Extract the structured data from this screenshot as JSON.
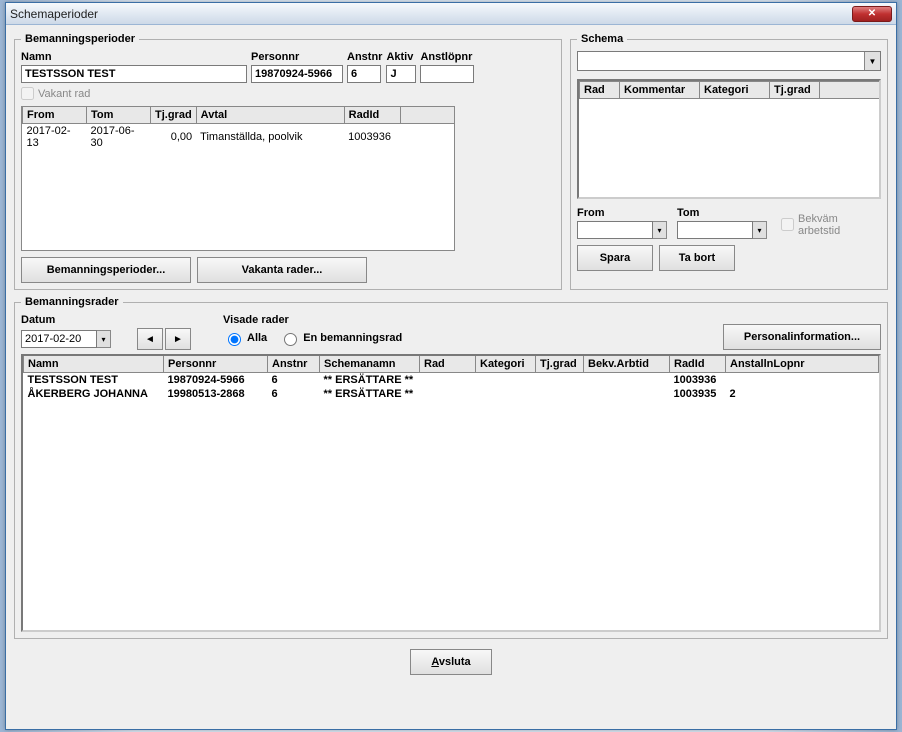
{
  "window": {
    "title": "Schemaperioder"
  },
  "bemanning": {
    "legend": "Bemanningsperioder",
    "fields": {
      "namn_label": "Namn",
      "namn": "TESTSSON TEST",
      "personnr_label": "Personnr",
      "personnr": "19870924-5966",
      "anstnr_label": "Anstnr",
      "anstnr": "6",
      "aktiv_label": "Aktiv",
      "aktiv": "J",
      "anstlopnr_label": "Anstlöpnr",
      "anstlopnr": ""
    },
    "vakant_label": "Vakant rad",
    "table": {
      "headers": [
        "From",
        "Tom",
        "Tj.grad",
        "Avtal",
        "RadId"
      ],
      "rows": [
        {
          "from": "2017-02-13",
          "tom": "2017-06-30",
          "tjgrad": "0,00",
          "avtal": "Timanställda, poolvik",
          "radid": "1003936"
        }
      ]
    },
    "btn_perioder": "Bemanningsperioder...",
    "btn_vakanta": "Vakanta rader..."
  },
  "schema": {
    "legend": "Schema",
    "dropdown_value": "",
    "grid_headers": [
      "Rad",
      "Kommentar",
      "Kategori",
      "Tj.grad"
    ],
    "from_label": "From",
    "from": "",
    "tom_label": "Tom",
    "tom": "",
    "bekvam_label": "Bekväm arbetstid",
    "btn_spara": "Spara",
    "btn_tabort": "Ta bort"
  },
  "rader": {
    "legend": "Bemanningsrader",
    "datum_label": "Datum",
    "datum": "2017-02-20",
    "visade_label": "Visade rader",
    "radio_alla": "Alla",
    "radio_en": "En bemanningsrad",
    "btn_personal": "Personalinformation...",
    "table": {
      "headers": [
        "Namn",
        "Personnr",
        "Anstnr",
        "Schemanamn",
        "Rad",
        "Kategori",
        "Tj.grad",
        "Bekv.Arbtid",
        "RadId",
        "AnstallnLopnr"
      ],
      "rows": [
        {
          "namn": "TESTSSON TEST",
          "personnr": "19870924-5966",
          "anstnr": "6",
          "schemanamn": "** ERSÄTTARE **",
          "rad": "",
          "kategori": "",
          "tjgrad": "",
          "bekv": "",
          "radid": "1003936",
          "lopnr": ""
        },
        {
          "namn": "ÅKERBERG JOHANNA",
          "personnr": "19980513-2868",
          "anstnr": "6",
          "schemanamn": "** ERSÄTTARE **",
          "rad": "",
          "kategori": "",
          "tjgrad": "",
          "bekv": "",
          "radid": "1003935",
          "lopnr": "2"
        }
      ]
    }
  },
  "footer": {
    "avsluta": "Avsluta"
  }
}
